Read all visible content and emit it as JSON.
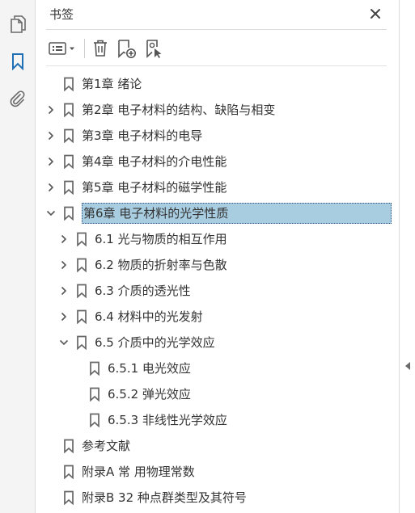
{
  "panel": {
    "title": "书签",
    "close_icon": "close-icon"
  },
  "left_rail": {
    "items": [
      {
        "icon": "pages-icon",
        "active": false
      },
      {
        "icon": "bookmark-icon",
        "active": true
      },
      {
        "icon": "attachment-icon",
        "active": false
      }
    ]
  },
  "toolbar": {
    "buttons": [
      "options-menu-icon",
      "delete-icon",
      "new-bookmark-icon",
      "bookmark-from-selection-icon"
    ]
  },
  "colors": {
    "accent": "#1f6fb5",
    "selection": "#a8cce0",
    "icon": "#6a6a6a"
  },
  "bookmarks": [
    {
      "label": "第1章 绪论",
      "level": 0,
      "twisty": "none"
    },
    {
      "label": "第2章 电子材料的结构、缺陷与相变",
      "level": 0,
      "twisty": "collapsed"
    },
    {
      "label": "第3章 电子材料的电导",
      "level": 0,
      "twisty": "collapsed"
    },
    {
      "label": "第4章 电子材料的介电性能",
      "level": 0,
      "twisty": "collapsed"
    },
    {
      "label": "第5章 电子材料的磁学性能",
      "level": 0,
      "twisty": "collapsed"
    },
    {
      "label": "第6章 电子材料的光学性质",
      "level": 0,
      "twisty": "expanded",
      "selected": true
    },
    {
      "label": "6.1 光与物质的相互作用",
      "level": 1,
      "twisty": "collapsed"
    },
    {
      "label": "6.2 物质的折射率与色散",
      "level": 1,
      "twisty": "collapsed"
    },
    {
      "label": "6.3 介质的透光性",
      "level": 1,
      "twisty": "collapsed"
    },
    {
      "label": "6.4 材料中的光发射",
      "level": 1,
      "twisty": "collapsed"
    },
    {
      "label": "6.5 介质中的光学效应",
      "level": 1,
      "twisty": "expanded"
    },
    {
      "label": "6.5.1 电光效应",
      "level": 2,
      "twisty": "none"
    },
    {
      "label": "6.5.2 弹光效应",
      "level": 2,
      "twisty": "none"
    },
    {
      "label": "6.5.3 非线性光学效应",
      "level": 2,
      "twisty": "none"
    },
    {
      "label": "参考文献",
      "level": 0,
      "twisty": "none"
    },
    {
      "label": "附录A 常 用物理常数",
      "level": 0,
      "twisty": "none"
    },
    {
      "label": "附录B 32 种点群类型及其符号",
      "level": 0,
      "twisty": "none"
    }
  ],
  "right_strip": {
    "collapse_icon": "collapse-panel-icon"
  }
}
